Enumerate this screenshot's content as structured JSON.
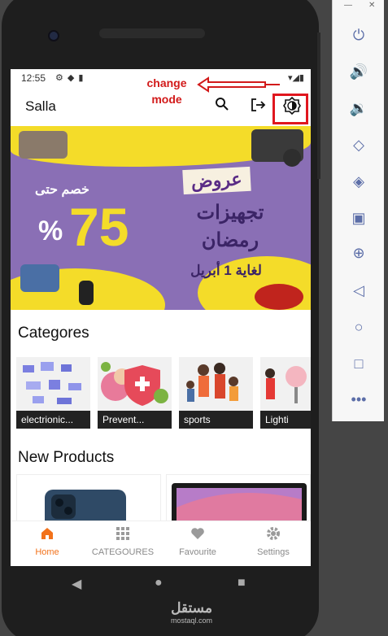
{
  "status": {
    "time": "12:55"
  },
  "appbar": {
    "title": "Salla"
  },
  "annotation": {
    "text1": "change",
    "text2": "mode"
  },
  "banner": {
    "discount_label": "خصم حتى",
    "number": "75",
    "percent": "%",
    "offer": "عروض",
    "line1": "تجهيزات",
    "line2": "رمضان",
    "line3": "لغاية 1 أبريل"
  },
  "categories": {
    "title": "Categores",
    "items": [
      {
        "label": "electrionic..."
      },
      {
        "label": "Prevent..."
      },
      {
        "label": "sports"
      },
      {
        "label": "Lighti"
      }
    ]
  },
  "products": {
    "title": "New Products"
  },
  "bottom_nav": [
    {
      "label": "Home",
      "icon": "home-icon"
    },
    {
      "label": "CATEGOURES",
      "icon": "grid-icon"
    },
    {
      "label": "Favourite",
      "icon": "heart-icon"
    },
    {
      "label": "Settings",
      "icon": "gear-icon"
    }
  ],
  "watermark": {
    "ar": "مستقل",
    "en": "mostaql.com"
  },
  "colors": {
    "accent": "#f2721b",
    "annotation": "#e0161e",
    "banner_purple": "#8a6fb5",
    "banner_yellow": "#f4dc29"
  }
}
